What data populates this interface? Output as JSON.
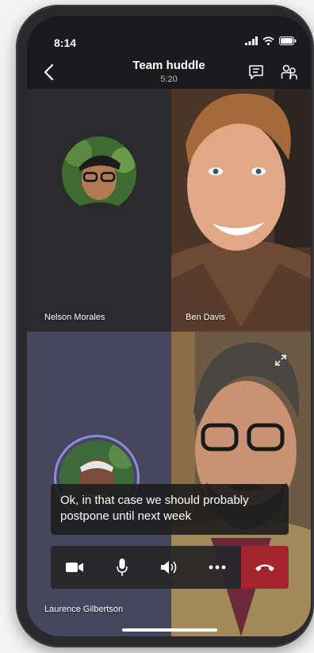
{
  "status_bar": {
    "time": "8:14"
  },
  "header": {
    "title": "Team huddle",
    "timer": "5:20"
  },
  "participants": [
    {
      "name": "Nelson Morales"
    },
    {
      "name": "Ben Davis"
    },
    {
      "name": "Laurence Gilbertson"
    }
  ],
  "caption": {
    "text": "Ok, in that case we should probably postpone until next week"
  },
  "colors": {
    "hangup": "#a4262c",
    "speaking_ring": "#8f8bd6",
    "tile_dark": "#2b2b2d",
    "tile_purple": "#474660"
  },
  "icons": {
    "back": "chevron-left-icon",
    "chat": "chat-icon",
    "people": "people-icon",
    "camera": "video-camera-icon",
    "mic": "microphone-icon",
    "speaker": "speaker-icon",
    "more": "more-icon",
    "hangup": "hang-up-icon",
    "expand": "expand-icon"
  }
}
